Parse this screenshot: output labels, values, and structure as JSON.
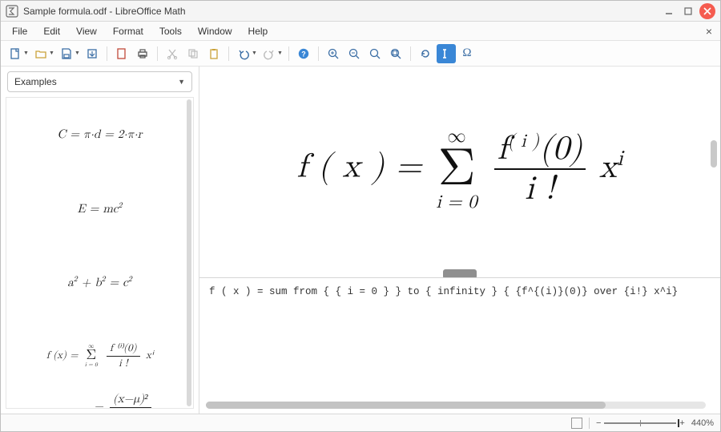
{
  "title": "Sample formula.odf - LibreOffice Math",
  "menu": [
    "File",
    "Edit",
    "View",
    "Format",
    "Tools",
    "Window",
    "Help"
  ],
  "sidebar": {
    "dropdown": "Examples"
  },
  "examples": {
    "e1_html": "C = π·d = 2·π·r",
    "e2_lhs": "E = mc",
    "e2_exp": "2",
    "e3_a": "a",
    "e3_b": "b",
    "e3_c": "c",
    "e3_exp": "2",
    "e4_lhs": "f (x) =",
    "e4_sum_top": "∞",
    "e4_sum_bot": "i = 0",
    "e4_num": "f ⁽ⁱ⁾(0)",
    "e4_den": "i !",
    "e4_tail": "xⁱ",
    "e5_num": "(x−μ)²",
    "e5_prefix": "−"
  },
  "formula": {
    "lhs": "f ( x ) =",
    "sum_top": "∞",
    "sum_bot": "i = 0",
    "frac_num_a": "f",
    "frac_num_sup": "( i )",
    "frac_num_b": "(0)",
    "frac_den": "i !",
    "tail_base": "x",
    "tail_exp": "i"
  },
  "editor": {
    "code": "f ( x ) = sum from { { i = 0 } } to { infinity } { {f^{(i)}(0)} over {i!} x^i}"
  },
  "status": {
    "zoom": "440%"
  },
  "icons": {
    "sigma": "Σ",
    "omega": "Ω",
    "infinity": "∞"
  }
}
